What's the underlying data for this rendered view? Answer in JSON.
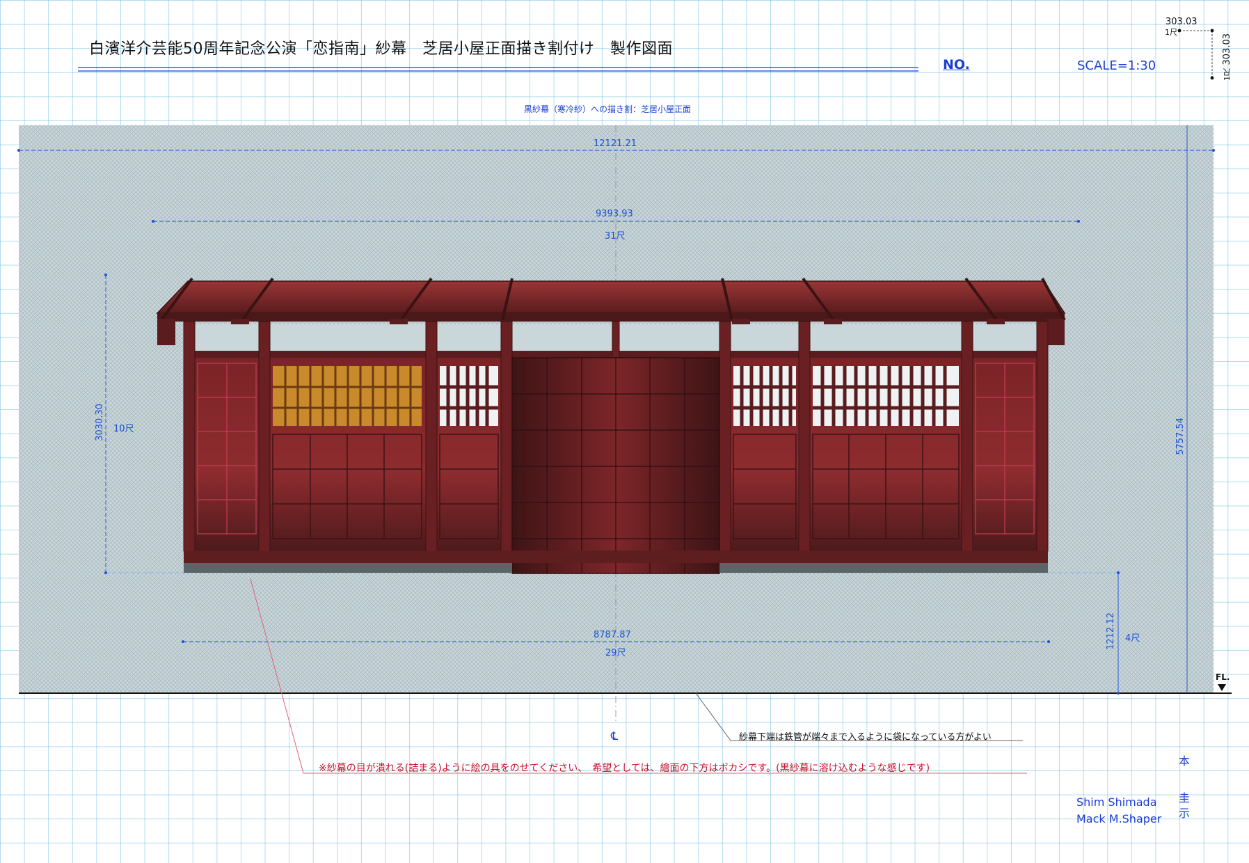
{
  "title": "白濱洋介芸能50周年記念公演「恋指南」紗幕　芝居小屋正面描き割付け　製作図面",
  "no_label": "NO.",
  "scale_label": "SCALE=1:30",
  "subtitle": "黒紗幕（寒冷紗）への描き割：芝居小屋正面",
  "dimensions": {
    "overall_width": "12121.21",
    "roof_width": "9393.93",
    "roof_width_shaku": "31尺",
    "base_width": "8787.87",
    "base_width_shaku": "29尺",
    "facade_height": "3030.30",
    "facade_height_shaku": "10尺",
    "overall_height": "5757.54",
    "floor_offset": "1212.12",
    "floor_offset_shaku": "4尺",
    "scale_ref_top": "303.03",
    "scale_ref_top_shaku": "1尺",
    "scale_ref_side": "303.03",
    "scale_ref_side_shaku": "1尺"
  },
  "fl_label": "FL.",
  "centerline_mark": "℄",
  "note_black": "紗幕下端は鉄管が端々まで入るように袋になっている方がよい",
  "note_red": "※紗幕の目が潰れる(詰まる)ように絵の具をのせてください、　希望としては、繪面の下方はボカシです。(黒紗幕に溶け込むような感じです)",
  "credits": [
    "Shim Shimada",
    "Mack M.Shaper"
  ],
  "stamp_chars": [
    "本",
    "圭",
    "示"
  ],
  "colors": {
    "scrim": "#c3d1d6",
    "wood_dark": "#5a1c1f",
    "wood_red": "#8e2a2d",
    "dim_blue": "#1a4fd8",
    "note_red": "#c8102e",
    "lattice_yellow": "#c98a2b"
  }
}
